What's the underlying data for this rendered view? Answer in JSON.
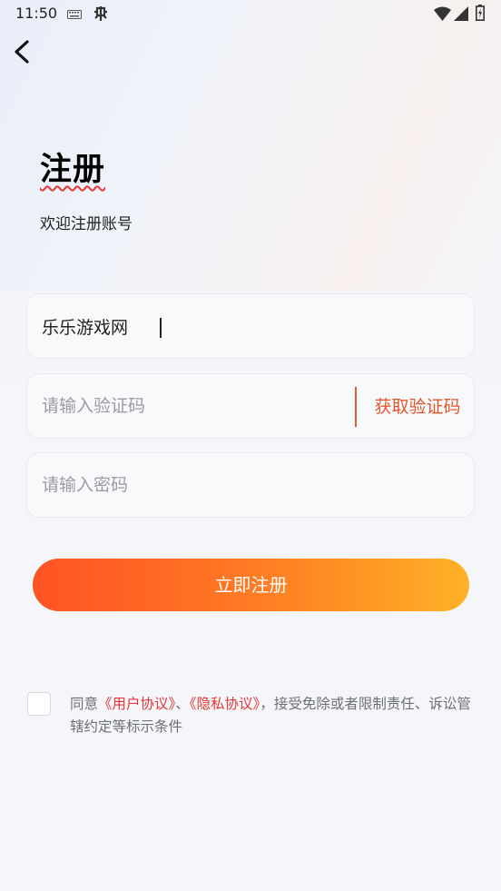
{
  "status_bar": {
    "time": "11:50"
  },
  "header": {
    "back_icon": "chevron-left-icon",
    "title": "注册",
    "subtitle": "欢迎注册账号"
  },
  "form": {
    "account": {
      "value": "乐乐游戏网",
      "placeholder": ""
    },
    "code": {
      "value": "",
      "placeholder": "请输入验证码",
      "button_label": "获取验证码"
    },
    "password": {
      "value": "",
      "placeholder": "请输入密码"
    },
    "submit_label": "立即注册"
  },
  "agreement": {
    "checked": false,
    "prefix": "同意",
    "user_agreement": "《用户协议》",
    "separator": "、",
    "privacy_agreement": "《隐私协议》",
    "suffix": "，接受免除或者限制责任、诉讼管辖约定等标示条件"
  },
  "colors": {
    "accent": "#e2552b",
    "link": "#e53935",
    "button_gradient_start": "#ff5224",
    "button_gradient_end": "#ffb126"
  }
}
